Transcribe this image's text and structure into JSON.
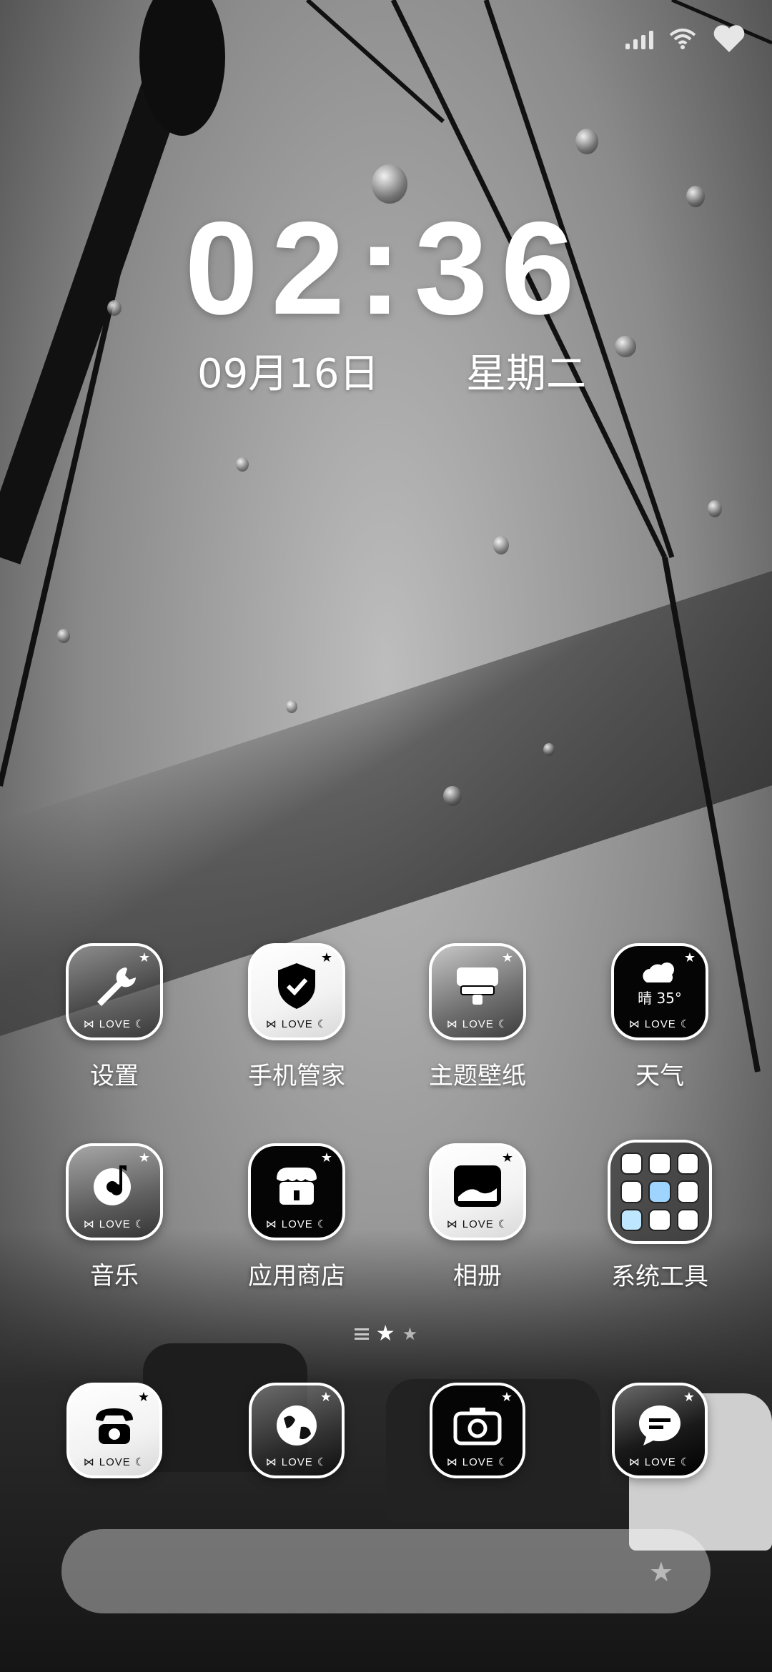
{
  "status_bar": {
    "signal_icon": "signal-bars-icon",
    "wifi_icon": "wifi-icon",
    "heart_icon": "heart-icon"
  },
  "clock": {
    "time": "02:36",
    "date": "09月16日",
    "weekday": "星期二"
  },
  "apps_row1": [
    {
      "name": "settings",
      "label": "设置",
      "love": "LOVE",
      "icon": "wrench-icon"
    },
    {
      "name": "phone-manager",
      "label": "手机管家",
      "love": "LOVE",
      "icon": "shield-check-icon"
    },
    {
      "name": "theme-wallpaper",
      "label": "主题壁纸",
      "love": "LOVE",
      "icon": "brush-icon"
    },
    {
      "name": "weather",
      "label": "天气",
      "love": "LOVE",
      "icon": "cloud-sun-icon",
      "weather_text": "晴 35°"
    }
  ],
  "apps_row2": [
    {
      "name": "music",
      "label": "音乐",
      "love": "LOVE",
      "icon": "music-icon"
    },
    {
      "name": "app-store",
      "label": "应用商店",
      "love": "LOVE",
      "icon": "store-icon"
    },
    {
      "name": "gallery",
      "label": "相册",
      "love": "LOVE",
      "icon": "photo-icon"
    },
    {
      "name": "system-tools",
      "label": "系统工具",
      "icon": "folder-icon"
    }
  ],
  "dock": [
    {
      "name": "phone",
      "love": "LOVE",
      "icon": "telephone-icon"
    },
    {
      "name": "browser",
      "love": "LOVE",
      "icon": "globe-icon"
    },
    {
      "name": "camera",
      "love": "LOVE",
      "icon": "camera-icon"
    },
    {
      "name": "messages",
      "love": "LOVE",
      "icon": "message-icon"
    }
  ],
  "page_indicator": {
    "current": 1,
    "total": 2
  },
  "colors": {
    "label": "#ffffff",
    "icon_dark": "#000000",
    "icon_light": "#ffffff"
  }
}
